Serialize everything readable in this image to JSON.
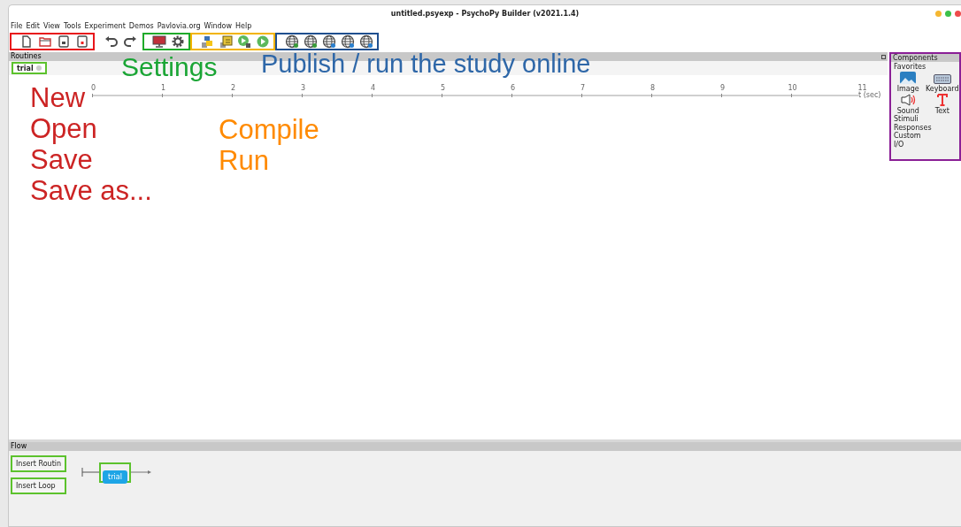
{
  "window": {
    "title": "untitled.psyexp - PsychoPy Builder (v2021.1.4)"
  },
  "menu": [
    "File",
    "Edit",
    "View",
    "Tools",
    "Experiment",
    "Demos",
    "Pavlovia.org",
    "Window",
    "Help"
  ],
  "toolbar_highlights": [
    {
      "color": "#e8161c"
    },
    {
      "color": "#1faa2a"
    },
    {
      "color": "#f2b400"
    },
    {
      "color": "#1f4f8f"
    }
  ],
  "routines": {
    "header": "Routines",
    "tabs": [
      {
        "label": "trial",
        "selected": true,
        "outlined": true
      }
    ],
    "ticks": [
      "0",
      "1",
      "2",
      "3",
      "4",
      "5",
      "6",
      "7",
      "8",
      "9",
      "10",
      "11"
    ],
    "axis_label": "t (sec)"
  },
  "components": {
    "header": "Components",
    "favorites_label": "Favorites",
    "favorites": [
      {
        "label": "Image"
      },
      {
        "label": "Keyboard"
      },
      {
        "label": "Sound"
      },
      {
        "label": "Text"
      }
    ],
    "categories": [
      "Stimuli",
      "Responses",
      "Custom",
      "I/O"
    ]
  },
  "flow": {
    "header": "Flow",
    "buttons": [
      {
        "label": "Insert Routin",
        "outlined": true
      },
      {
        "label": "Insert Loop",
        "outlined": true
      }
    ],
    "routine": {
      "label": "trial",
      "outlined": true
    }
  },
  "annotations": [
    {
      "lines": [
        "Settings"
      ],
      "color": "#1aa535"
    },
    {
      "lines": [
        "Publish / run the study online"
      ],
      "color": "#2e67a8"
    },
    {
      "lines": [
        "New",
        "Open",
        "Save",
        "Save as..."
      ],
      "color": "#cc2424"
    },
    {
      "lines": [
        "Compile",
        "Run"
      ],
      "color": "#ff8a00"
    }
  ]
}
